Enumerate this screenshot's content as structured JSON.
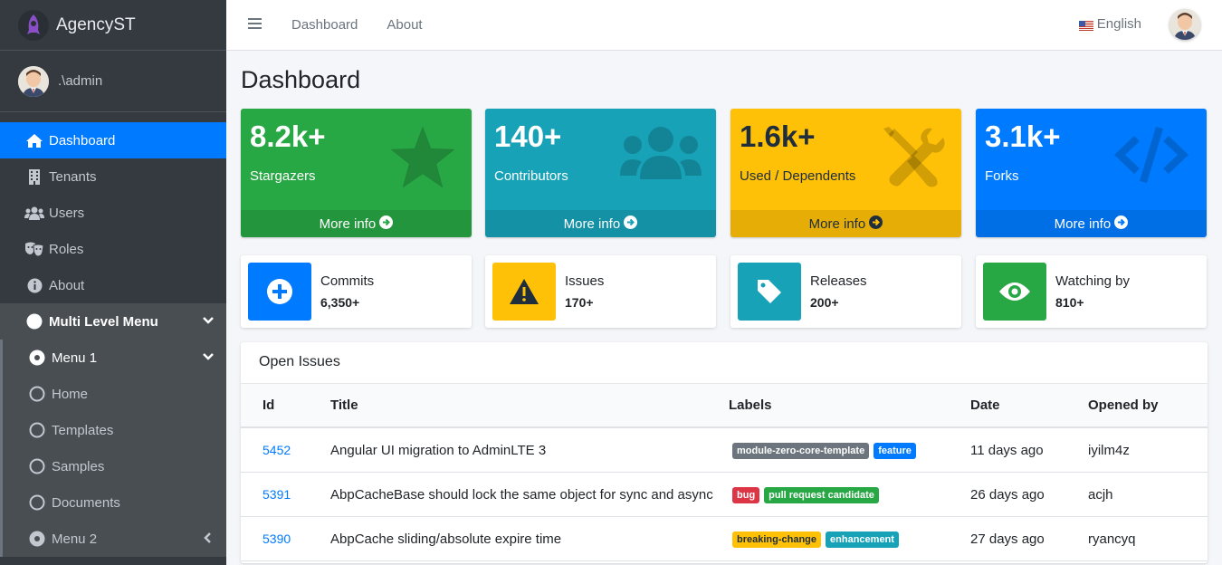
{
  "brand": {
    "name": "AgencyST"
  },
  "user": {
    "name": ".\\admin"
  },
  "sidebar": {
    "items": [
      {
        "label": "Dashboard",
        "icon": "home-icon"
      },
      {
        "label": "Tenants",
        "icon": "building-icon"
      },
      {
        "label": "Users",
        "icon": "users-icon"
      },
      {
        "label": "Roles",
        "icon": "theater-masks-icon"
      },
      {
        "label": "About",
        "icon": "info-circle-icon"
      },
      {
        "label": "Multi Level Menu",
        "icon": "circle-icon"
      },
      {
        "label": "Menu 1",
        "icon": "dot-circle-icon"
      },
      {
        "label": "Home",
        "icon": "circle-outline-icon"
      },
      {
        "label": "Templates",
        "icon": "circle-outline-icon"
      },
      {
        "label": "Samples",
        "icon": "circle-outline-icon"
      },
      {
        "label": "Documents",
        "icon": "circle-outline-icon"
      },
      {
        "label": "Menu 2",
        "icon": "dot-circle-icon"
      }
    ]
  },
  "topbar": {
    "links": [
      "Dashboard",
      "About"
    ],
    "language": "English"
  },
  "page": {
    "title": "Dashboard"
  },
  "stats": [
    {
      "value": "8.2k+",
      "label": "Stargazers",
      "more": "More info",
      "color": "#28a745"
    },
    {
      "value": "140+",
      "label": "Contributors",
      "more": "More info",
      "color": "#17a2b8"
    },
    {
      "value": "1.6k+",
      "label": "Used / Dependents",
      "more": "More info",
      "color": "#ffc107"
    },
    {
      "value": "3.1k+",
      "label": "Forks",
      "more": "More info",
      "color": "#007bff"
    }
  ],
  "info_boxes": [
    {
      "label": "Commits",
      "value": "6,350+"
    },
    {
      "label": "Issues",
      "value": "170+"
    },
    {
      "label": "Releases",
      "value": "200+"
    },
    {
      "label": "Watching by",
      "value": "810+"
    }
  ],
  "issues": {
    "title": "Open Issues",
    "columns": [
      "Id",
      "Title",
      "Labels",
      "Date",
      "Opened by"
    ],
    "rows": [
      {
        "id": "5452",
        "title": "Angular UI migration to AdminLTE 3",
        "labels": [
          "module-zero-core-template",
          "feature"
        ],
        "date": "11 days ago",
        "by": "iyilm4z"
      },
      {
        "id": "5391",
        "title": "AbpCacheBase should lock the same object for sync and async",
        "labels": [
          "bug",
          "pull request candidate"
        ],
        "date": "26 days ago",
        "by": "acjh"
      },
      {
        "id": "5390",
        "title": "AbpCache sliding/absolute expire time",
        "labels": [
          "breaking-change",
          "enhancement"
        ],
        "date": "27 days ago",
        "by": "ryancyq"
      }
    ]
  }
}
